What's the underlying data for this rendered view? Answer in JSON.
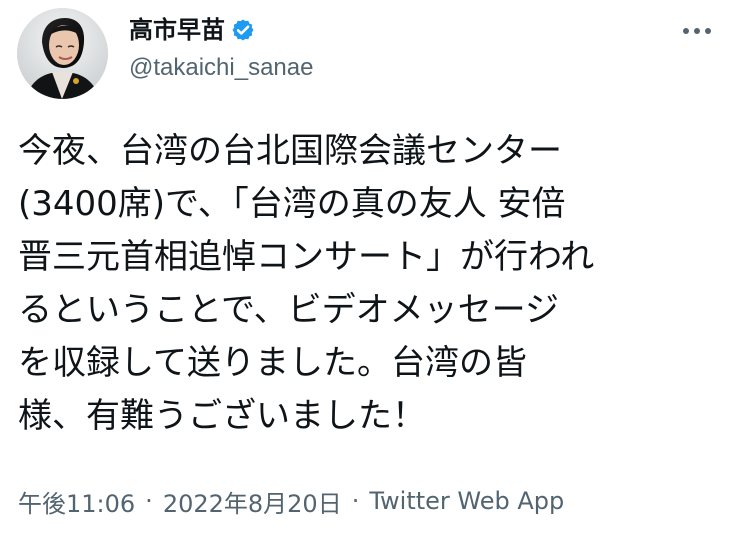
{
  "author": {
    "display_name": "高市早苗",
    "handle": "@takaichi_sanae",
    "verified": true,
    "avatar_icon": "profile-photo",
    "verified_icon": "verified-badge-icon",
    "more_icon": "more-options-icon"
  },
  "tweet": {
    "text": "今夜、台湾の台北国際会議センター\n(3400席)で、「台湾の真の友人 安倍\n晋三元首相追悼コンサート」が行われ\nるということで、ビデオメッセージ\nを収録して送りました。台湾の皆\n様、有難うございました！"
  },
  "meta": {
    "time": "午後11:06",
    "separator": "·",
    "date": "2022年8月20日",
    "source": "Twitter Web App"
  },
  "colors": {
    "text_primary": "#0f1419",
    "text_secondary": "#536471",
    "verified_blue": "#1d9bf0",
    "background": "#ffffff"
  }
}
